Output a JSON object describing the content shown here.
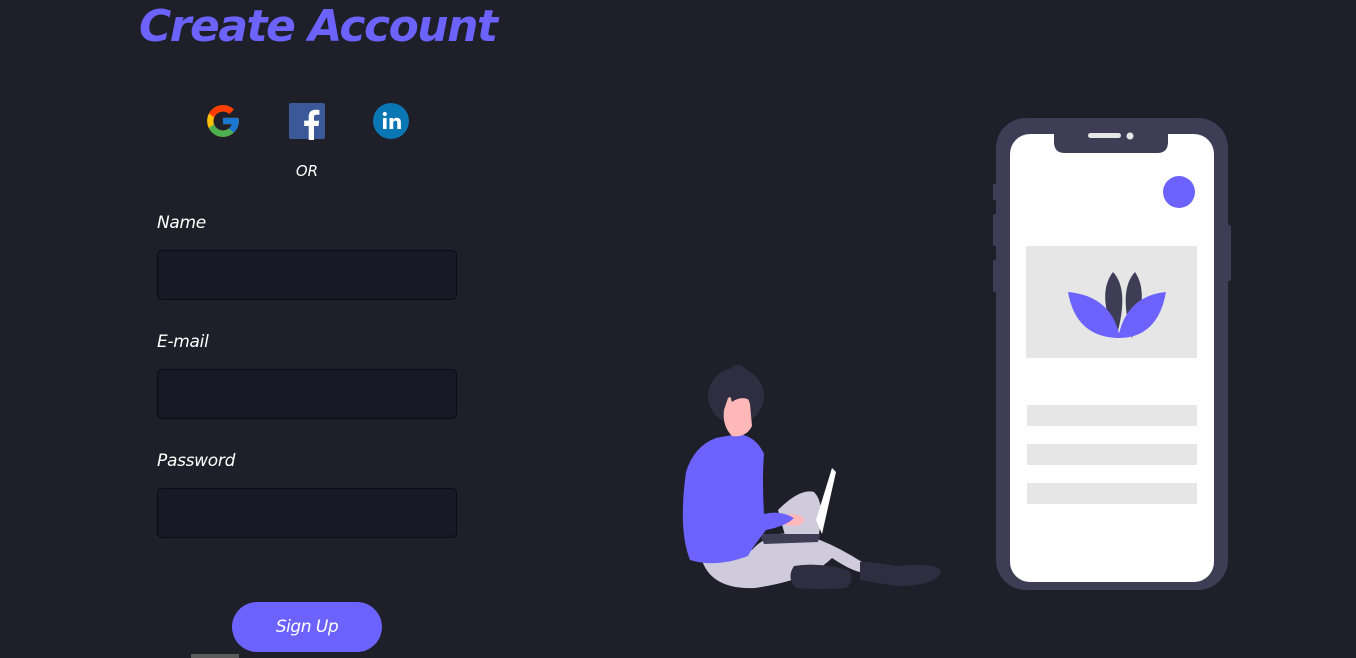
{
  "page": {
    "title": "Create Account"
  },
  "social": {
    "items": [
      {
        "icon": "google-icon"
      },
      {
        "icon": "facebook-icon"
      },
      {
        "icon": "linkedin-icon"
      }
    ],
    "divider_text": "OR"
  },
  "form": {
    "name_label": "Name",
    "name_value": "",
    "email_label": "E-mail",
    "email_value": "",
    "password_label": "Password",
    "password_value": "",
    "submit_label": "Sign Up"
  },
  "colors": {
    "background": "#1e1f28",
    "accent": "#6c63ff",
    "input_background": "#171924",
    "text": "#ffffff"
  }
}
